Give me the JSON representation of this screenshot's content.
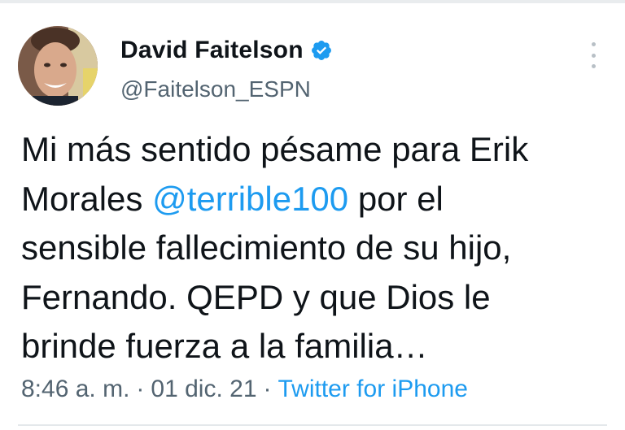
{
  "tweet": {
    "author": {
      "name": "David Faitelson",
      "handle": "@Faitelson_ESPN",
      "verified": true
    },
    "text": {
      "line1": "Mi más sentido pésame para Erik",
      "line2_before": "Morales ",
      "mention": "@terrible100",
      "line2_after": " por el",
      "line3": "sensible fallecimiento de su hijo,",
      "line4": "Fernando. QEPD y que Dios le",
      "line5": "brinde fuerza a la familia…"
    },
    "meta": {
      "time": "8:46 a. m.",
      "separator": "·",
      "date": "01 dic. 21",
      "source": "Twitter for iPhone"
    }
  },
  "icons": {
    "verified": "verified-badge-icon",
    "more": "more-options-icon"
  },
  "colors": {
    "link": "#1d9bf0",
    "secondary_text": "#536471",
    "primary_text": "#0f1419",
    "verified_badge": "#1d9bf0"
  }
}
